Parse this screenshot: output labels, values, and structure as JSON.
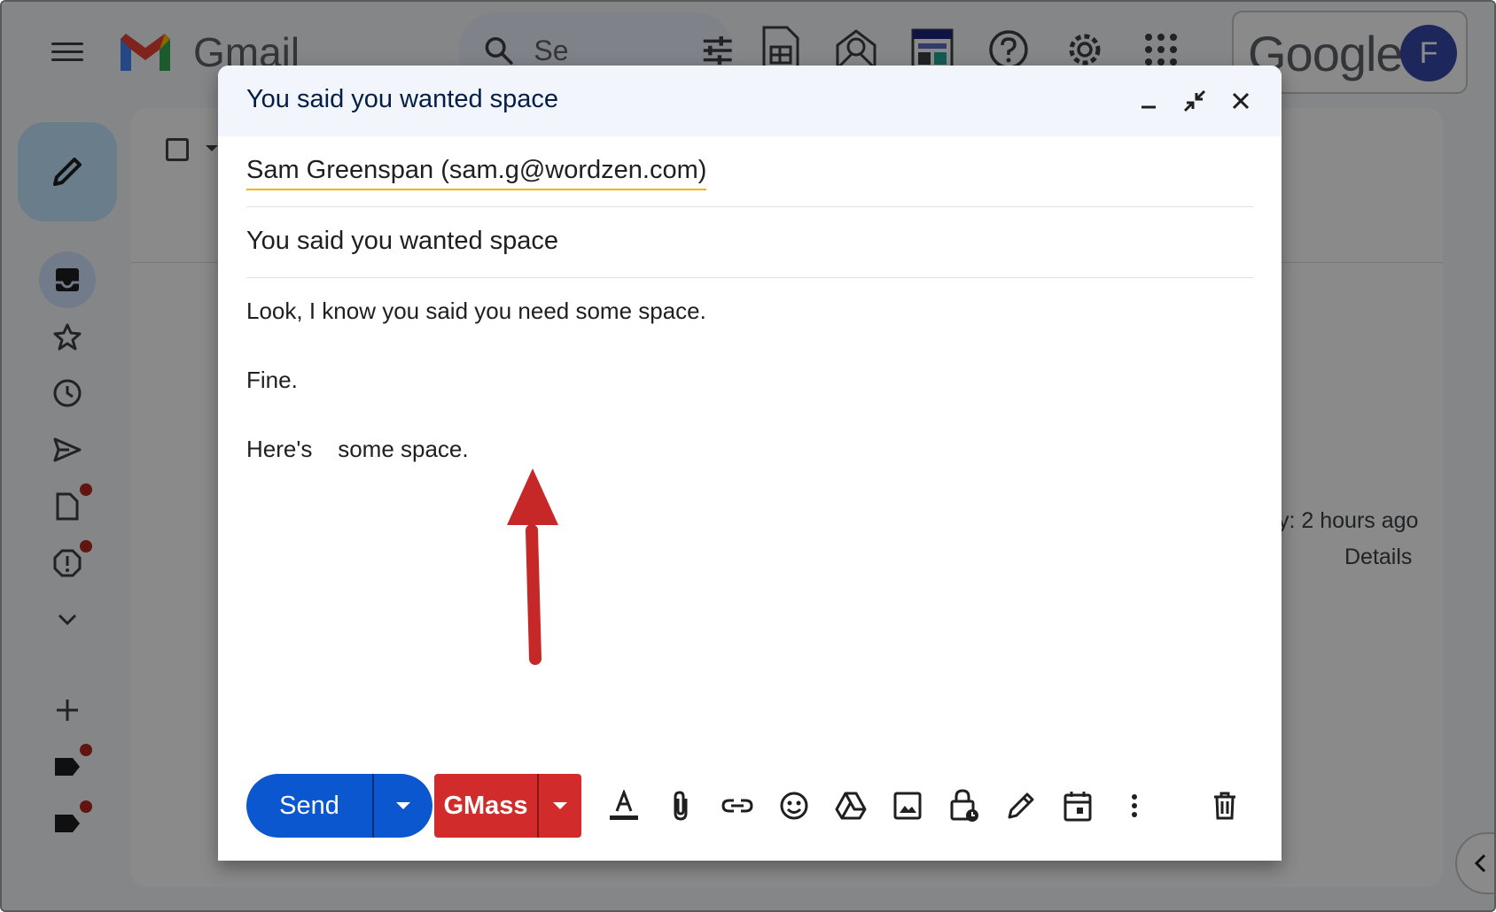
{
  "app": {
    "logo_text": "Gmail",
    "search_text": "Se",
    "google_word": "Google",
    "avatar_letter": "F"
  },
  "background": {
    "activity_text": "y: 2 hours ago",
    "details_link": "Details"
  },
  "compose": {
    "title": "You said you wanted space",
    "recipient": "Sam Greenspan (sam.g@wordzen.com)",
    "subject": "You said you wanted space",
    "body_lines": [
      "Look, I know you said you need some space.",
      "Fine.",
      "Here's    some space."
    ],
    "send_label": "Send",
    "gmass_label": "GMass"
  },
  "colors": {
    "send_button": "#0b57d0",
    "gmass_button": "#d22b2b",
    "annotation_arrow": "#c62828",
    "recipient_underline": "#f4b400"
  },
  "icons": {
    "toolbar": [
      "format-text-icon",
      "attach-icon",
      "link-icon",
      "emoji-icon",
      "drive-icon",
      "photo-icon",
      "confidential-icon",
      "signature-icon",
      "schedule-icon",
      "more-options-icon"
    ]
  }
}
